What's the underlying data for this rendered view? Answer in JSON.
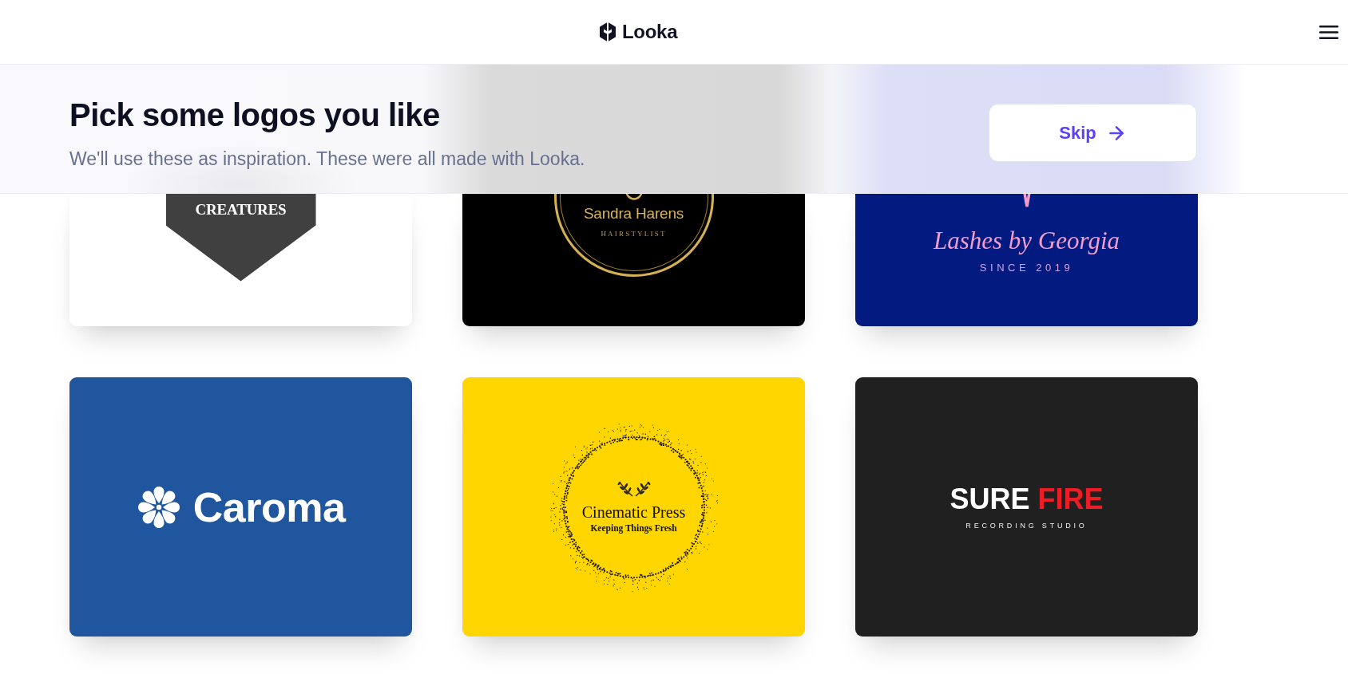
{
  "header": {
    "brand": "Looka"
  },
  "banner": {
    "title": "Pick some logos you like",
    "subtitle": "We'll use these as inspiration. These were all made with Looka.",
    "skip_button": "Skip"
  },
  "logos": [
    {
      "kind": "badge",
      "color": "#ffffff",
      "selected": false,
      "name": "CREATURES"
    },
    {
      "kind": "ring",
      "color": "#000000",
      "selected": false,
      "name": "Sandra Harens",
      "tagline": "HAIRSTYLIST"
    },
    {
      "kind": "script",
      "color": "#031b80",
      "selected": false,
      "name": "Lashes by Georgia",
      "tagline": "SINCE 2019"
    },
    {
      "kind": "flower",
      "color": "#1f569e",
      "selected": false,
      "name": "Caroma"
    },
    {
      "kind": "stipple",
      "color": "#ffd600",
      "selected": false,
      "name": "Cinematic Press",
      "tagline": "Keeping Things Fresh"
    },
    {
      "kind": "wordmark",
      "color": "#202020",
      "selected": false,
      "words": [
        {
          "text": "SURE",
          "color": "#ffffff"
        },
        {
          "text": "FIRE",
          "color": "#ee1c24"
        }
      ],
      "tagline": "RECORDING STUDIO"
    }
  ]
}
